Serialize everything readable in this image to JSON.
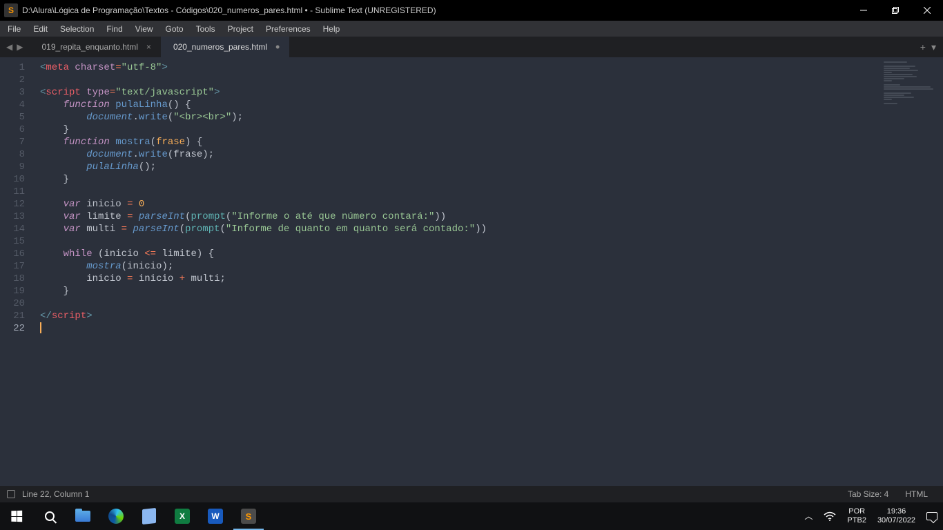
{
  "titlebar": {
    "app_icon_letter": "S",
    "title": "D:\\Alura\\Lógica de Programação\\Textos - Códigos\\020_numeros_pares.html • - Sublime Text (UNREGISTERED)"
  },
  "menubar": [
    "File",
    "Edit",
    "Selection",
    "Find",
    "View",
    "Goto",
    "Tools",
    "Project",
    "Preferences",
    "Help"
  ],
  "tabs": {
    "nav_back": "◀",
    "nav_fwd": "▶",
    "items": [
      {
        "label": "019_repita_enquanto.html",
        "active": false,
        "dirty": false
      },
      {
        "label": "020_numeros_pares.html",
        "active": true,
        "dirty": true
      }
    ],
    "new_tab": "+",
    "dropdown": "▾"
  },
  "editor": {
    "line_count": 22,
    "code_tokens": [
      [
        {
          "t": "<",
          "c": "punc"
        },
        {
          "t": "meta",
          "c": "tag"
        },
        {
          "t": " ",
          "c": "plain"
        },
        {
          "t": "charset",
          "c": "attr"
        },
        {
          "t": "=",
          "c": "op"
        },
        {
          "t": "\"utf-8\"",
          "c": "string"
        },
        {
          "t": ">",
          "c": "punc"
        }
      ],
      [],
      [
        {
          "t": "<",
          "c": "punc"
        },
        {
          "t": "script",
          "c": "tag"
        },
        {
          "t": " ",
          "c": "plain"
        },
        {
          "t": "type",
          "c": "attr"
        },
        {
          "t": "=",
          "c": "op"
        },
        {
          "t": "\"text/javascript\"",
          "c": "string"
        },
        {
          "t": ">",
          "c": "punc"
        }
      ],
      [
        {
          "t": "    ",
          "c": "plain"
        },
        {
          "t": "function",
          "c": "storage"
        },
        {
          "t": " ",
          "c": "plain"
        },
        {
          "t": "pulaLinha",
          "c": "fn-name"
        },
        {
          "t": "() {",
          "c": "paren"
        }
      ],
      [
        {
          "t": "        ",
          "c": "plain"
        },
        {
          "t": "document",
          "c": "obj-it"
        },
        {
          "t": ".",
          "c": "plain"
        },
        {
          "t": "write",
          "c": "fn-name"
        },
        {
          "t": "(",
          "c": "paren"
        },
        {
          "t": "\"<br><br>\"",
          "c": "string"
        },
        {
          "t": ");",
          "c": "paren"
        }
      ],
      [
        {
          "t": "    }",
          "c": "paren"
        }
      ],
      [
        {
          "t": "    ",
          "c": "plain"
        },
        {
          "t": "function",
          "c": "storage"
        },
        {
          "t": " ",
          "c": "plain"
        },
        {
          "t": "mostra",
          "c": "fn-name"
        },
        {
          "t": "(",
          "c": "paren"
        },
        {
          "t": "frase",
          "c": "param"
        },
        {
          "t": ") {",
          "c": "paren"
        }
      ],
      [
        {
          "t": "        ",
          "c": "plain"
        },
        {
          "t": "document",
          "c": "obj-it"
        },
        {
          "t": ".",
          "c": "plain"
        },
        {
          "t": "write",
          "c": "fn-name"
        },
        {
          "t": "(",
          "c": "paren"
        },
        {
          "t": "frase",
          "c": "var"
        },
        {
          "t": ");",
          "c": "paren"
        }
      ],
      [
        {
          "t": "        ",
          "c": "plain"
        },
        {
          "t": "pulaLinha",
          "c": "fn-call2"
        },
        {
          "t": "();",
          "c": "paren"
        }
      ],
      [
        {
          "t": "    }",
          "c": "paren"
        }
      ],
      [],
      [
        {
          "t": "    ",
          "c": "plain"
        },
        {
          "t": "var",
          "c": "storage"
        },
        {
          "t": " ",
          "c": "plain"
        },
        {
          "t": "inicio",
          "c": "var"
        },
        {
          "t": " ",
          "c": "plain"
        },
        {
          "t": "=",
          "c": "op"
        },
        {
          "t": " ",
          "c": "plain"
        },
        {
          "t": "0",
          "c": "num"
        }
      ],
      [
        {
          "t": "    ",
          "c": "plain"
        },
        {
          "t": "var",
          "c": "storage"
        },
        {
          "t": " ",
          "c": "plain"
        },
        {
          "t": "limite",
          "c": "var"
        },
        {
          "t": " ",
          "c": "plain"
        },
        {
          "t": "=",
          "c": "op"
        },
        {
          "t": " ",
          "c": "plain"
        },
        {
          "t": "parseInt",
          "c": "fn-call2"
        },
        {
          "t": "(",
          "c": "paren"
        },
        {
          "t": "prompt",
          "c": "fn-call"
        },
        {
          "t": "(",
          "c": "paren"
        },
        {
          "t": "\"Informe o até que número contará:\"",
          "c": "string"
        },
        {
          "t": "))",
          "c": "paren"
        }
      ],
      [
        {
          "t": "    ",
          "c": "plain"
        },
        {
          "t": "var",
          "c": "storage"
        },
        {
          "t": " ",
          "c": "plain"
        },
        {
          "t": "multi",
          "c": "var"
        },
        {
          "t": " ",
          "c": "plain"
        },
        {
          "t": "=",
          "c": "op"
        },
        {
          "t": " ",
          "c": "plain"
        },
        {
          "t": "parseInt",
          "c": "fn-call2"
        },
        {
          "t": "(",
          "c": "paren"
        },
        {
          "t": "prompt",
          "c": "fn-call"
        },
        {
          "t": "(",
          "c": "paren"
        },
        {
          "t": "\"Informe de quanto em quanto será contado:\"",
          "c": "string"
        },
        {
          "t": "))",
          "c": "paren"
        }
      ],
      [],
      [
        {
          "t": "    ",
          "c": "plain"
        },
        {
          "t": "while",
          "c": "kw2"
        },
        {
          "t": " (",
          "c": "paren"
        },
        {
          "t": "inicio",
          "c": "var"
        },
        {
          "t": " ",
          "c": "plain"
        },
        {
          "t": "<=",
          "c": "op"
        },
        {
          "t": " ",
          "c": "plain"
        },
        {
          "t": "limite",
          "c": "var"
        },
        {
          "t": ") {",
          "c": "paren"
        }
      ],
      [
        {
          "t": "        ",
          "c": "plain"
        },
        {
          "t": "mostra",
          "c": "fn-call2"
        },
        {
          "t": "(",
          "c": "paren"
        },
        {
          "t": "inicio",
          "c": "var"
        },
        {
          "t": ");",
          "c": "paren"
        }
      ],
      [
        {
          "t": "        ",
          "c": "plain"
        },
        {
          "t": "inicio",
          "c": "var"
        },
        {
          "t": " ",
          "c": "plain"
        },
        {
          "t": "=",
          "c": "op"
        },
        {
          "t": " ",
          "c": "plain"
        },
        {
          "t": "inicio",
          "c": "var"
        },
        {
          "t": " ",
          "c": "plain"
        },
        {
          "t": "+",
          "c": "op"
        },
        {
          "t": " ",
          "c": "plain"
        },
        {
          "t": "multi",
          "c": "var"
        },
        {
          "t": ";",
          "c": "paren"
        }
      ],
      [
        {
          "t": "    }",
          "c": "paren"
        }
      ],
      [],
      [
        {
          "t": "</",
          "c": "punc"
        },
        {
          "t": "script",
          "c": "tag"
        },
        {
          "t": ">",
          "c": "punc"
        }
      ],
      []
    ],
    "cursor_line": 22
  },
  "statusbar": {
    "position": "Line 22, Column 1",
    "tab_size": "Tab Size: 4",
    "syntax": "HTML"
  },
  "taskbar": {
    "excel_letter": "X",
    "word_letter": "W",
    "sublime_letter": "S",
    "lang": "POR",
    "kbd": "PTB2",
    "time": "19:36",
    "date": "30/07/2022"
  }
}
